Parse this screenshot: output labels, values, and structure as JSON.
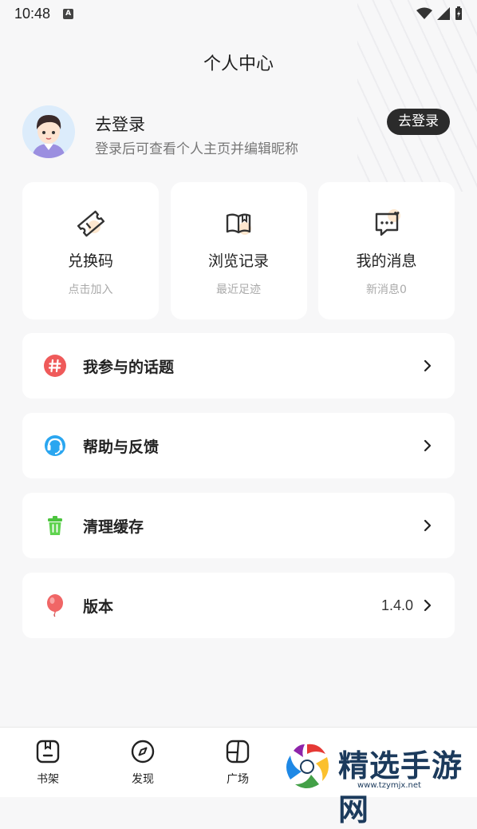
{
  "status_bar": {
    "time": "10:48",
    "sim_letter": "A"
  },
  "header": {
    "title": "个人中心"
  },
  "profile": {
    "name": "去登录",
    "hint": "登录后可查看个人主页并编辑昵称",
    "login_button": "去登录"
  },
  "cards": [
    {
      "title": "兑换码",
      "subtitle": "点击加入",
      "icon": "ticket-icon"
    },
    {
      "title": "浏览记录",
      "subtitle": "最近足迹",
      "icon": "book-icon"
    },
    {
      "title": "我的消息",
      "subtitle": "新消息0",
      "icon": "message-icon"
    }
  ],
  "menu": [
    {
      "label": "我参与的话题",
      "icon": "hashtag-icon",
      "color": "#ef5a5a"
    },
    {
      "label": "帮助与反馈",
      "icon": "headset-icon",
      "color": "#2aa6f0"
    },
    {
      "label": "清理缓存",
      "icon": "trash-icon",
      "color": "#4cc43e"
    },
    {
      "label": "版本",
      "value": "1.4.0",
      "icon": "balloon-icon",
      "color": "#f06666"
    }
  ],
  "tabbar": [
    {
      "label": "书架",
      "icon": "bookshelf-icon"
    },
    {
      "label": "发现",
      "icon": "compass-icon"
    },
    {
      "label": "广场",
      "icon": "square-icon"
    }
  ],
  "watermark": {
    "text": "精选手游网",
    "url": "www.tzymjx.net"
  }
}
